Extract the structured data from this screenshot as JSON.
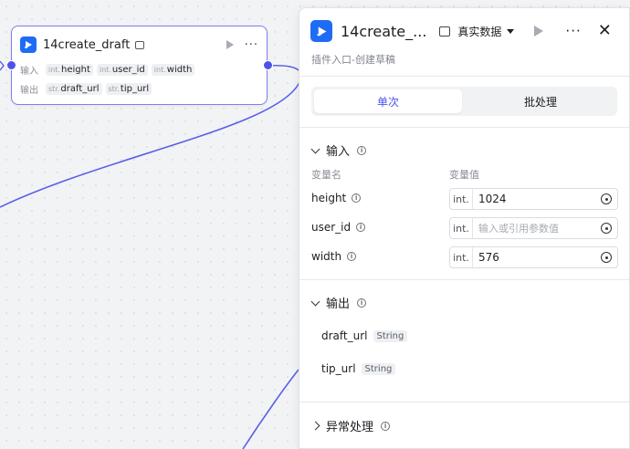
{
  "node": {
    "title": "14create_draft",
    "input_label": "输入",
    "output_label": "输出",
    "inputs": [
      {
        "type": "int.",
        "name": "height"
      },
      {
        "type": "int.",
        "name": "user_id"
      },
      {
        "type": "int.",
        "name": "width"
      }
    ],
    "outputs": [
      {
        "type": "str.",
        "name": "draft_url"
      },
      {
        "type": "str.",
        "name": "tip_url"
      }
    ]
  },
  "panel": {
    "title": "14create_...",
    "mode_label": "真实数据",
    "description": "插件入口-创建草稿",
    "tabs": {
      "single": "单次",
      "batch": "批处理"
    },
    "input_section": {
      "title": "输入",
      "col_name": "变量名",
      "col_value": "变量值",
      "rows": [
        {
          "name": "height",
          "type": "int.",
          "value": "1024",
          "placeholder": ""
        },
        {
          "name": "user_id",
          "type": "int.",
          "value": "",
          "placeholder": "输入或引用参数值"
        },
        {
          "name": "width",
          "type": "int.",
          "value": "576",
          "placeholder": ""
        }
      ]
    },
    "output_section": {
      "title": "输出",
      "rows": [
        {
          "name": "draft_url",
          "type": "String"
        },
        {
          "name": "tip_url",
          "type": "String"
        }
      ]
    },
    "error_section": {
      "title": "异常处理"
    }
  },
  "colors": {
    "accent": "#4d53e8",
    "logo": "#1e6cf5",
    "edge": "#5b5fe6"
  }
}
